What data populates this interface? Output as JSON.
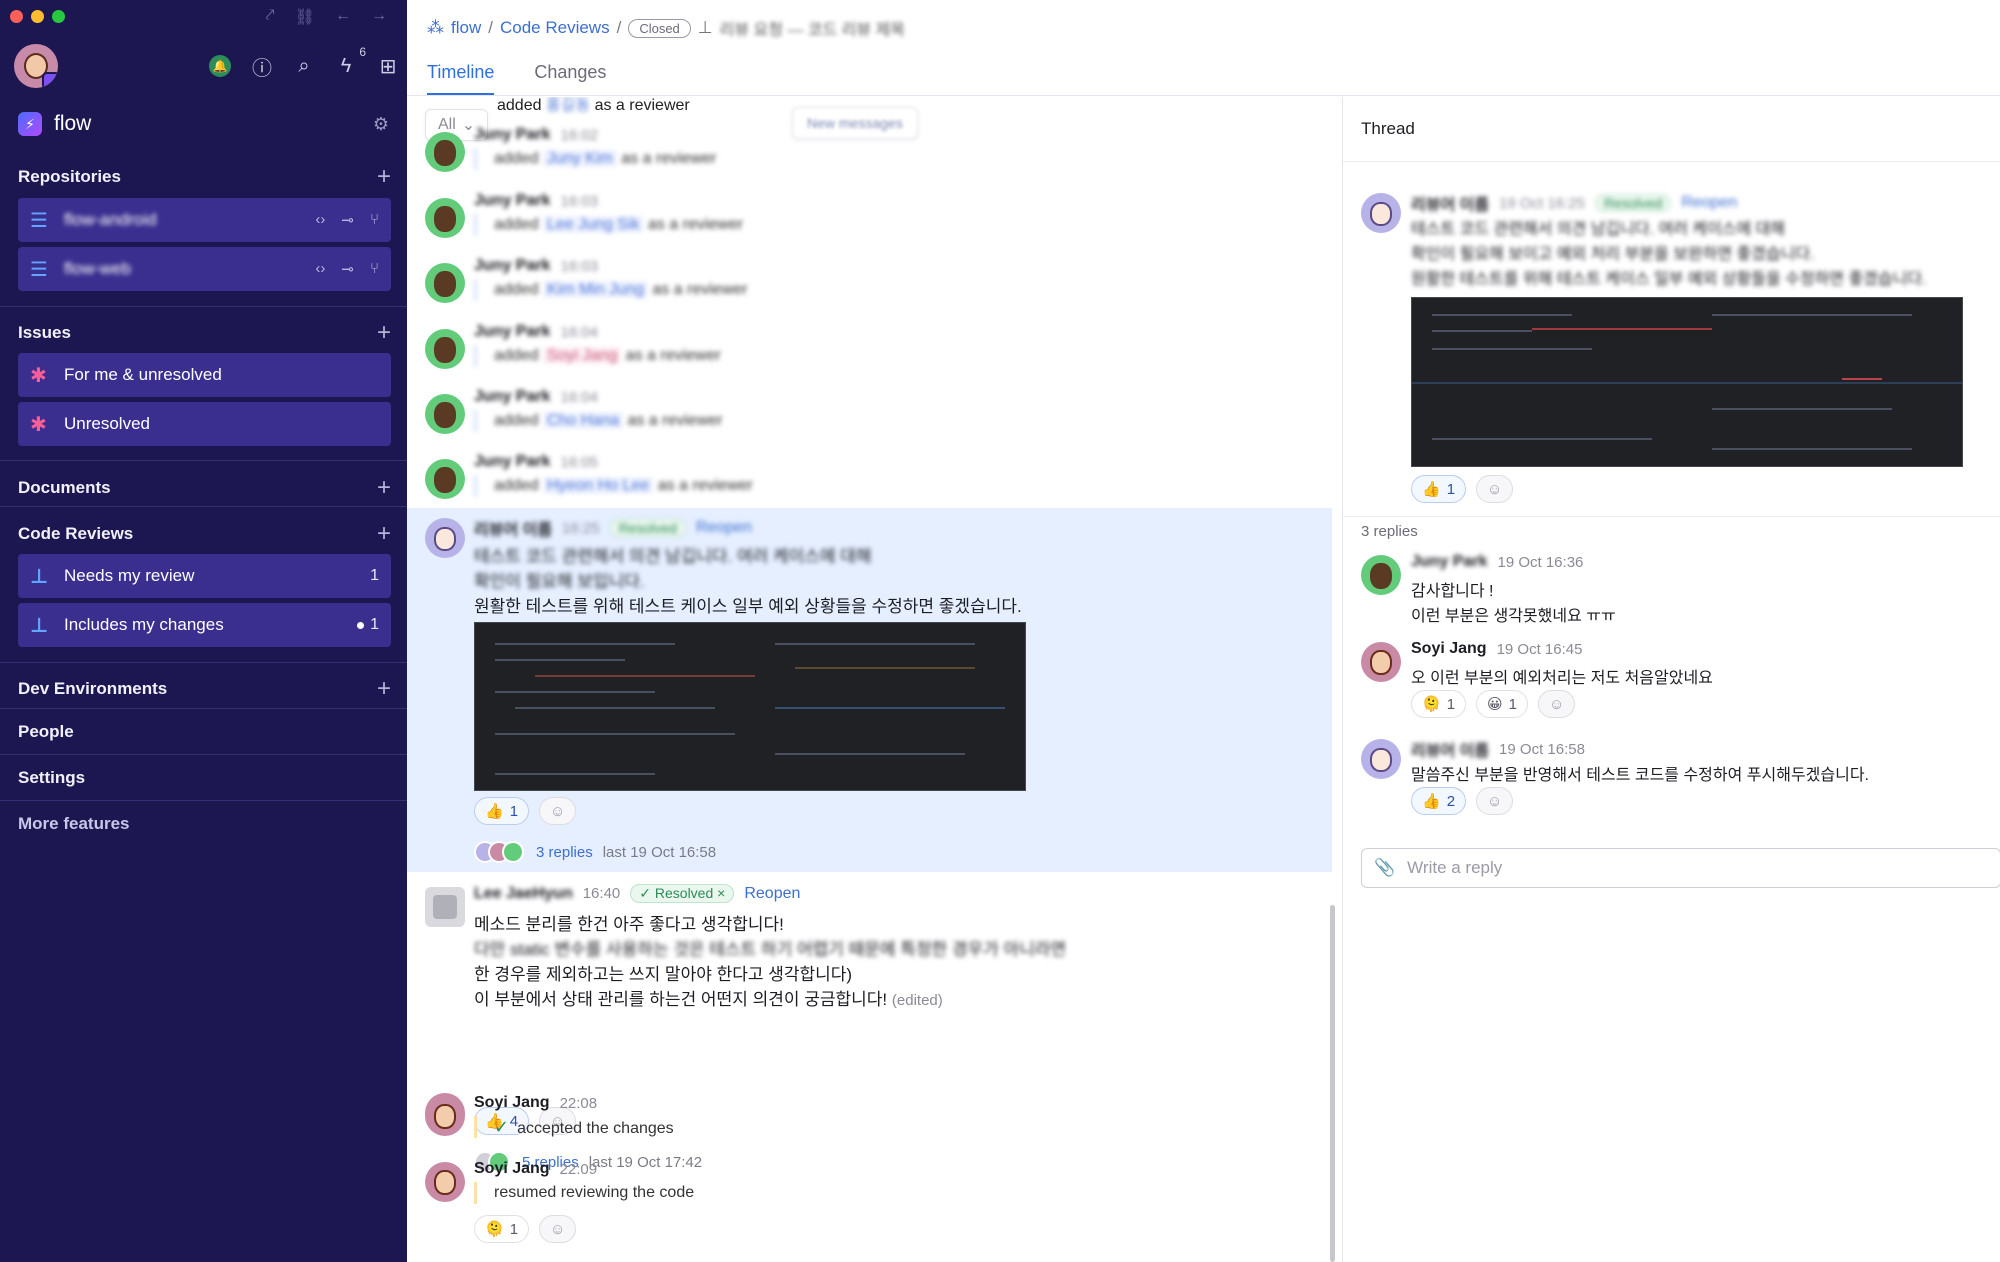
{
  "app": {
    "name": "flow"
  },
  "sidebar": {
    "notify_count": "6",
    "brand": "flow",
    "sections": {
      "repositories": "Repositories",
      "issues": "Issues",
      "documents": "Documents",
      "code_reviews": "Code Reviews",
      "dev_envs": "Dev Environments",
      "people": "People",
      "settings": "Settings",
      "more": "More features"
    },
    "repos": [
      {
        "label": "flow-android"
      },
      {
        "label": "flow-web"
      }
    ],
    "issues": [
      {
        "label": "For me & unresolved"
      },
      {
        "label": "Unresolved"
      }
    ],
    "reviews": [
      {
        "label": "Needs my review",
        "count": "1"
      },
      {
        "label": "Includes my changes",
        "count": "1"
      }
    ]
  },
  "header": {
    "crumb_root": "flow",
    "crumb_section": "Code Reviews",
    "status": "Closed",
    "title": "리뷰 요청 — 코드 리뷰 제목",
    "tabs": [
      "Timeline",
      "Changes"
    ]
  },
  "timeline": {
    "filter": "All",
    "floating_button": "New messages",
    "added_reviewer": {
      "prefix": "added",
      "name": "홍길동",
      "suffix": "as a reviewer"
    },
    "events": [
      {
        "author": "Juny Park",
        "time": "16:02",
        "action": "added",
        "target": "Juny Kim",
        "tail": "as a reviewer"
      },
      {
        "author": "Juny Park",
        "time": "16:03",
        "action": "added",
        "target": "Lee Jung Sik",
        "tail": "as a reviewer"
      },
      {
        "author": "Juny Park",
        "time": "16:03",
        "action": "added",
        "target": "Kim Min Jung",
        "tail": "as a reviewer"
      },
      {
        "author": "Juny Park",
        "time": "16:04",
        "action": "added",
        "target": "Soyi Jang",
        "tail": "as a reviewer"
      },
      {
        "author": "Juny Park",
        "time": "16:04",
        "action": "added",
        "target": "Cho Hana",
        "tail": "as a reviewer"
      },
      {
        "author": "Juny Park",
        "time": "16:05",
        "action": "added",
        "target": "Hyeon Ho Lee",
        "tail": "as a reviewer"
      }
    ],
    "comment1": {
      "author": "리뷰어 이름",
      "time": "16:25",
      "status": "Resolved",
      "reopen": "Reopen",
      "lines": [
        "테스트 코드 관련해서 의견 남깁니다. 여러 케이스에 대해",
        "확인이 필요해 보입니다.",
        "원활한 테스트를 위해 테스트 케이스 일부 예외 상황들을 수정하면 좋겠습니다."
      ],
      "reaction_thumbs": "1",
      "replies": "3 replies",
      "last": "last 19 Oct 16:58"
    },
    "comment2": {
      "author": "Lee JaeHyun",
      "time": "16:40",
      "status": "Resolved",
      "reopen": "Reopen",
      "lines": [
        "메소드 분리를 한건 아주 좋다고 생각합니다!",
        "다만 static 변수를 사용하는 것은 테스트 하기 어렵기 때문에 특정한 경우가 아니라면",
        "한 경우를 제외하고는 쓰지 말아야 한다고 생각합니다)",
        "이 부분에서 상태 관리를 하는건 어떤지 의견이 궁금합니다!"
      ],
      "edited": "(edited)",
      "reaction_thumbs": "4",
      "replies": "5 replies",
      "last": "last 19 Oct 17:42"
    },
    "accepted": {
      "author": "Soyi Jang",
      "time": "22:08",
      "text": "accepted the changes"
    },
    "resumed": {
      "author": "Soyi Jang",
      "time": "22:09",
      "text": "resumed reviewing the code",
      "reaction": "1"
    }
  },
  "thread": {
    "title": "Thread",
    "root": {
      "author": "리뷰어 이름",
      "time": "19 Oct 16:25",
      "status": "Resolved",
      "reopen": "Reopen",
      "lines": [
        "테스트 코드 관련해서 의견 남깁니다. 여러 케이스에 대해",
        "확인이 필요해 보이고 예외 처리 부분을 보완하면 좋겠습니다.",
        "원활한 테스트를 위해 테스트 케이스 일부 예외 상황들을 수정하면 좋겠습니다."
      ],
      "reaction_thumbs": "1"
    },
    "replies_count": "3 replies",
    "replies": [
      {
        "author": "Juny Park",
        "time": "19 Oct 16:36",
        "lines": [
          "감사합니다 !",
          "이런 부분은 생각못했네요 ㅠㅠ"
        ],
        "reactions": []
      },
      {
        "author": "Soyi Jang",
        "time": "19 Oct 16:45",
        "lines": [
          "오 이런 부분의 예외처리는 저도 처음알았네요"
        ],
        "reactions": [
          {
            "emoji": "🫠",
            "count": "1"
          },
          {
            "emoji": "😀",
            "count": "1"
          }
        ]
      },
      {
        "author": "리뷰어 이름",
        "time": "19 Oct 16:58",
        "lines": [
          "말씀주신 부분을 반영해서 테스트 코드를 수정하여 푸시해두겠습니다."
        ],
        "reactions": [
          {
            "emoji": "👍",
            "count": "2"
          }
        ]
      }
    ],
    "reply_placeholder": "Write a reply"
  },
  "colors": {
    "sidebar_bg": "#1c1750",
    "nav_active": "#3a2f8f",
    "accent": "#2f6fe0",
    "highlight": "#e5efff"
  }
}
